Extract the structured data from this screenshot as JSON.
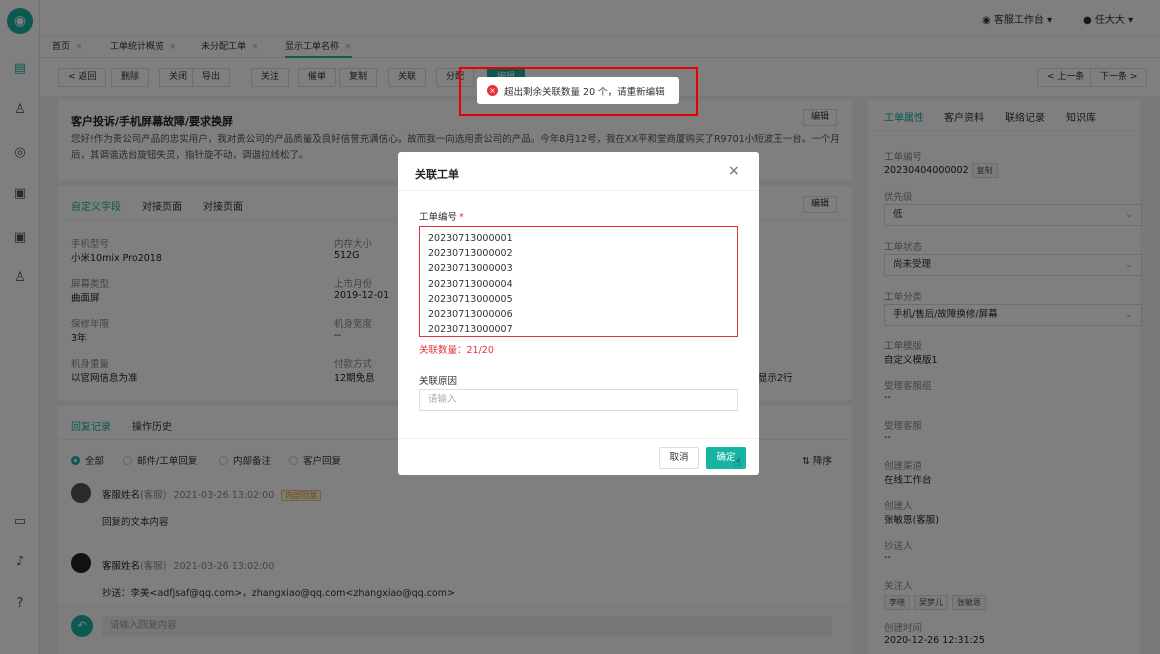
{
  "rail": {
    "logo": "tooth-logo"
  },
  "topbar": {
    "workspace_label": "客服工作台",
    "user_name": "任大大"
  },
  "tabs": [
    "首页",
    "工单统计概览",
    "未分配工单",
    "显示工单名称"
  ],
  "toolbar": {
    "back_label": "< 返回",
    "buttons": [
      "删除",
      "关闭",
      "导出",
      "关注",
      "催单",
      "复制",
      "关联",
      "分配",
      "编辑"
    ],
    "prev_label": "< 上一条",
    "next_label": "下一条 >"
  },
  "ticket": {
    "title": "客户投诉/手机屏幕故障/要求换屏",
    "edit_label": "编辑",
    "description": "您好!作为贵公司产品的忠实用户，我对贵公司的产品质量及良好信誉充满信心。故而我一向选用贵公司的产品。今年8月12号，我在XX平和堂商厦购买了R9701小短波王一台。一个月后，其调谐选台旋钮失灵，指针旋不动，调谐拉线松了。"
  },
  "custom_fields": {
    "tabs": [
      "自定义字段",
      "对接页面",
      "对接页面"
    ],
    "edit_label": "编辑",
    "fields": [
      {
        "label": "手机型号",
        "value": "小米10mix Pro2018"
      },
      {
        "label": "内存大小",
        "value": "512G"
      },
      {
        "label": "屏幕类型",
        "value": "曲面屏"
      },
      {
        "label": "上市月份",
        "value": "2019-12-01"
      },
      {
        "label": "保修年限",
        "value": "3年"
      },
      {
        "label": "机身宽度",
        "value": "--"
      },
      {
        "label": "机身重量",
        "value": "以官网信息为准"
      },
      {
        "label": "付款方式",
        "value": "12期免息"
      }
    ],
    "overflow_text": "显示2行"
  },
  "reply": {
    "tabs": [
      "回复记录",
      "操作历史"
    ],
    "filters": [
      "全部",
      "邮件/工单回复",
      "内部备注",
      "客户回复"
    ],
    "sort_label": "降序",
    "items": [
      {
        "name": "客服姓名",
        "role": "(客服)",
        "time": "2021-03-26 13:02:00",
        "badge": "内部回复",
        "content": "回复的文本内容"
      },
      {
        "name": "客服姓名",
        "role": "(客服)",
        "time": "2021-03-26 13:02:00",
        "badge": "",
        "content": "抄送：李美<adfjsaf@qq.com>，zhangxiao@qq.com<zhangxiao@qq.com>"
      }
    ],
    "input_placeholder": "请输入回复内容"
  },
  "sidebar": {
    "tabs": [
      "工单属性",
      "客户资料",
      "联络记录",
      "知识库"
    ],
    "ticket_no_label": "工单编号",
    "ticket_no": "20230404000002",
    "copy_label": "复制",
    "priority_label": "优先级",
    "priority": "低",
    "status_label": "工单状态",
    "status": "尚未受理",
    "category_label": "工单分类",
    "category": "手机/售后/故障换修/屏幕",
    "template_label": "工单模版",
    "template": "自定义模版1",
    "group_label": "受理客服组",
    "group": "--",
    "agent_label": "受理客服",
    "agent": "--",
    "channel_label": "创建渠道",
    "channel": "在线工作台",
    "creator_label": "创建人",
    "creator": "张敏恩(客服)",
    "cc_label": "抄送人",
    "cc": "--",
    "followers_label": "关注人",
    "followers": [
      "李晓",
      "吴梦儿",
      "张敏恩"
    ],
    "created_label": "创建时间",
    "created": "2020-12-26 12:31:25"
  },
  "toast": {
    "message": "超出剩余关联数量 20 个，请重新编辑"
  },
  "modal": {
    "title": "关联工单",
    "field_label": "工单编号",
    "required_mark": "*",
    "ticket_ids": [
      "20230713000001",
      "20230713000002",
      "20230713000003",
      "20230713000004",
      "20230713000005",
      "20230713000006",
      "20230713000007"
    ],
    "count_text": "关联数量：21/20",
    "reason_label": "关联原因",
    "reason_placeholder": "请输入",
    "cancel_label": "取消",
    "confirm_label": "确定"
  },
  "colors": {
    "accent": "#17b3a3",
    "error": "#e5333a",
    "highlight_box": "#e60000"
  }
}
